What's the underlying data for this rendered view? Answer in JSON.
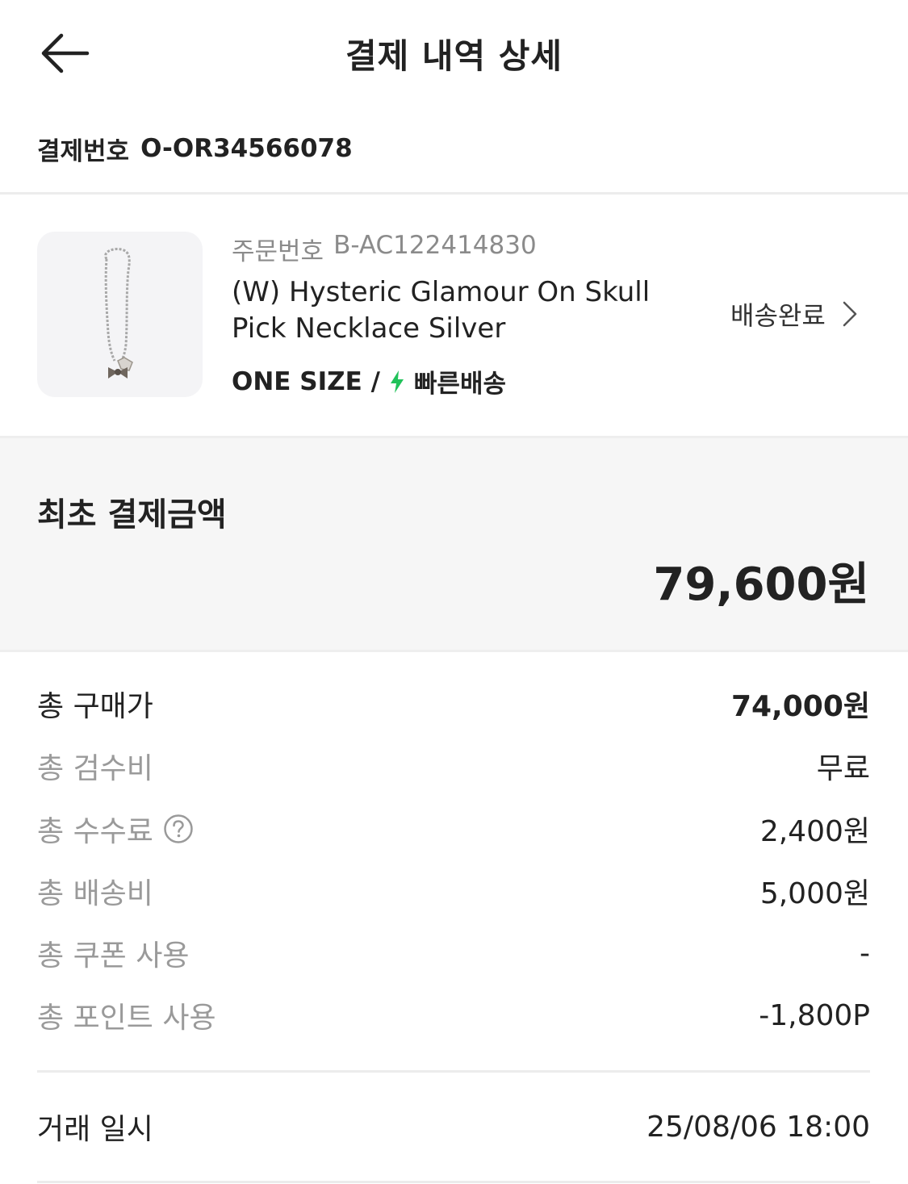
{
  "header": {
    "title": "결제 내역 상세",
    "back_icon": "arrow-left-icon"
  },
  "payment": {
    "label": "결제번호",
    "number": "O-OR34566078"
  },
  "product": {
    "order_label": "주문번호",
    "order_number": "B-AC122414830",
    "name": "(W) Hysteric Glamour On Skull Pick Necklace Silver",
    "size": "ONE SIZE /",
    "shipping_type": "빠른배송",
    "shipping_icon": "lightning-bolt-icon",
    "status": "배송완료",
    "image_alt": "necklace"
  },
  "initial_payment": {
    "label": "최초 결제금액",
    "amount": "79,600원"
  },
  "breakdown": [
    {
      "label": "총 구매가",
      "value": "74,000원"
    },
    {
      "label": "총 검수비",
      "value": "무료"
    },
    {
      "label": "총 수수료",
      "value": "2,400원",
      "help_icon": "question-circle-icon"
    },
    {
      "label": "총 배송비",
      "value": "5,000원"
    },
    {
      "label": "총 쿠폰 사용",
      "value": "-"
    },
    {
      "label": "총 포인트 사용",
      "value": "-1,800P"
    }
  ],
  "transaction": {
    "label": "거래 일시",
    "value": "25/08/06 18:00"
  },
  "colors": {
    "accent_green": "#21c25a",
    "text_primary": "#222222",
    "text_secondary": "#9a9a9a",
    "panel_bg": "#f6f6f6"
  }
}
